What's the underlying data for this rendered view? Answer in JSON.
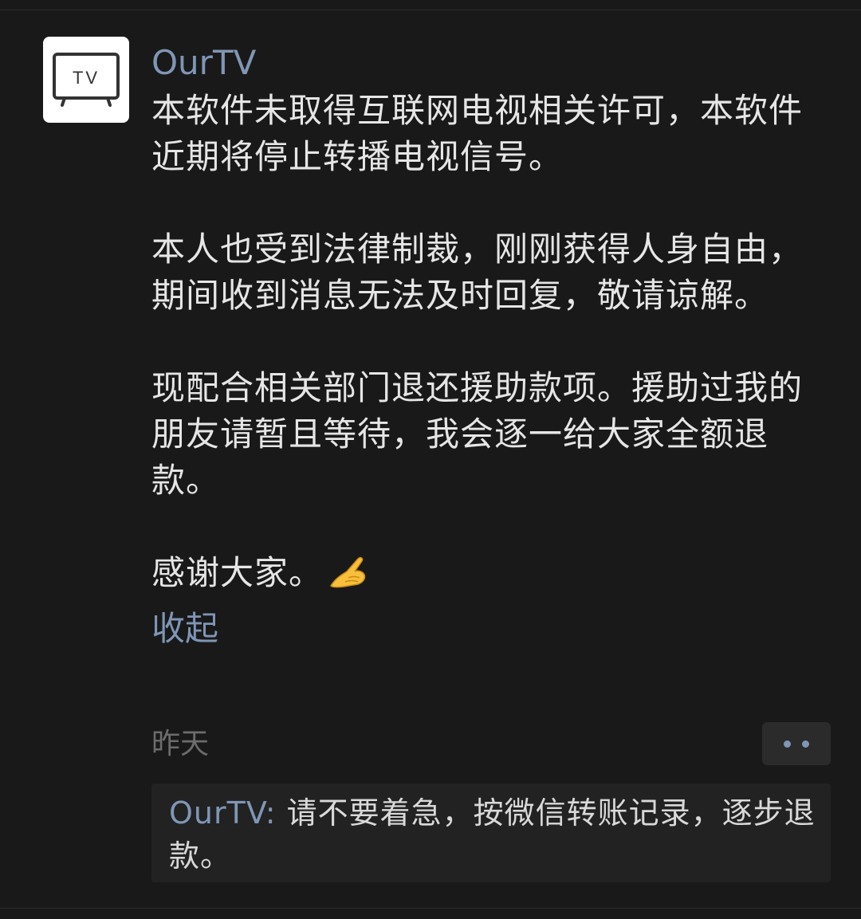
{
  "post": {
    "avatar_text": "TV",
    "author": "OurTV",
    "paragraphs": [
      "本软件未取得互联网电视相关许可，本软件近期将停止转播电视信号。",
      "本人也受到法律制裁，刚刚获得人身自由，期间收到消息无法及时回复，敬请谅解。",
      "现配合相关部门退还援助款项。援助过我的朋友请暂且等待，我会逐一给大家全额退款。",
      "感谢大家。"
    ],
    "emoji_icon": "pinched-hand-emoji",
    "collapse_label": "收起",
    "timestamp": "昨天"
  },
  "comment": {
    "author": "OurTV",
    "separator": ": ",
    "text": "请不要着急，按微信转账记录，逐步退款。"
  },
  "colors": {
    "background": "#191919",
    "link": "#7f96b5",
    "text": "#e6e6e6",
    "muted": "#6c6c6c",
    "comment_bg": "#222222"
  }
}
